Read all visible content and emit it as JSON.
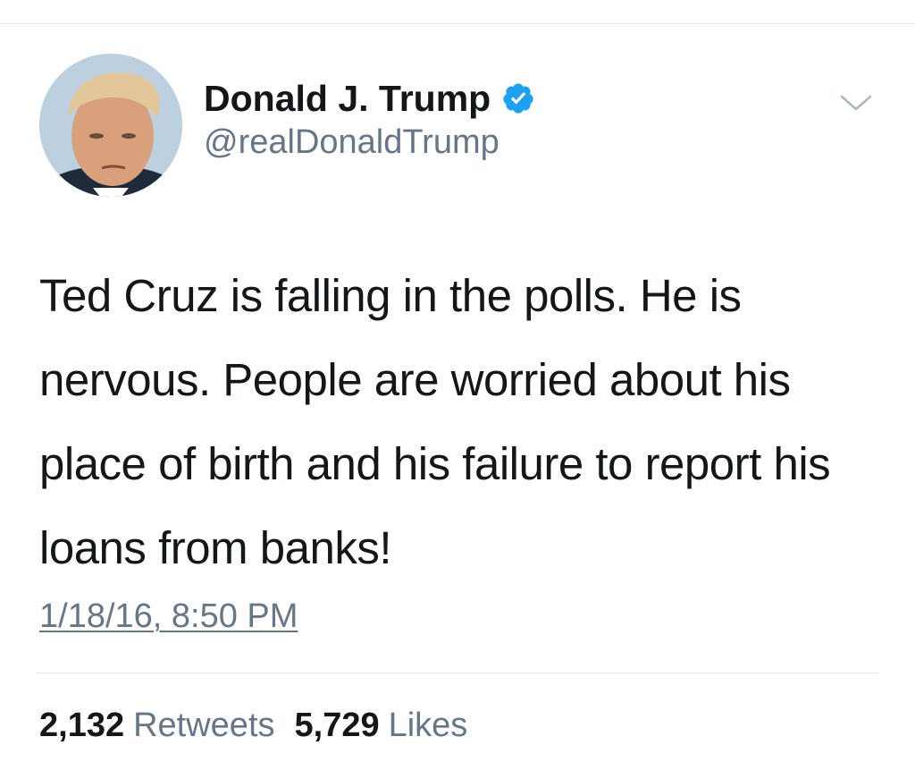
{
  "tweet": {
    "author": {
      "display_name": "Donald J. Trump",
      "handle": "@realDonaldTrump",
      "verified": true
    },
    "text": "Ted Cruz is falling in the polls. He is nervous. People are worried about his place of birth and his failure to report his loans from banks!",
    "timestamp": "1/18/16, 8:50 PM",
    "stats": {
      "retweets_count": "2,132",
      "retweets_label": "Retweets",
      "likes_count": "5,729",
      "likes_label": "Likes"
    }
  },
  "icons": {
    "verified": "verified-badge-icon",
    "menu": "chevron-down-icon"
  },
  "colors": {
    "verified_blue": "#1da1f2",
    "secondary_text": "#657786",
    "primary_text": "#14171a",
    "divider": "#e1e8ed"
  }
}
